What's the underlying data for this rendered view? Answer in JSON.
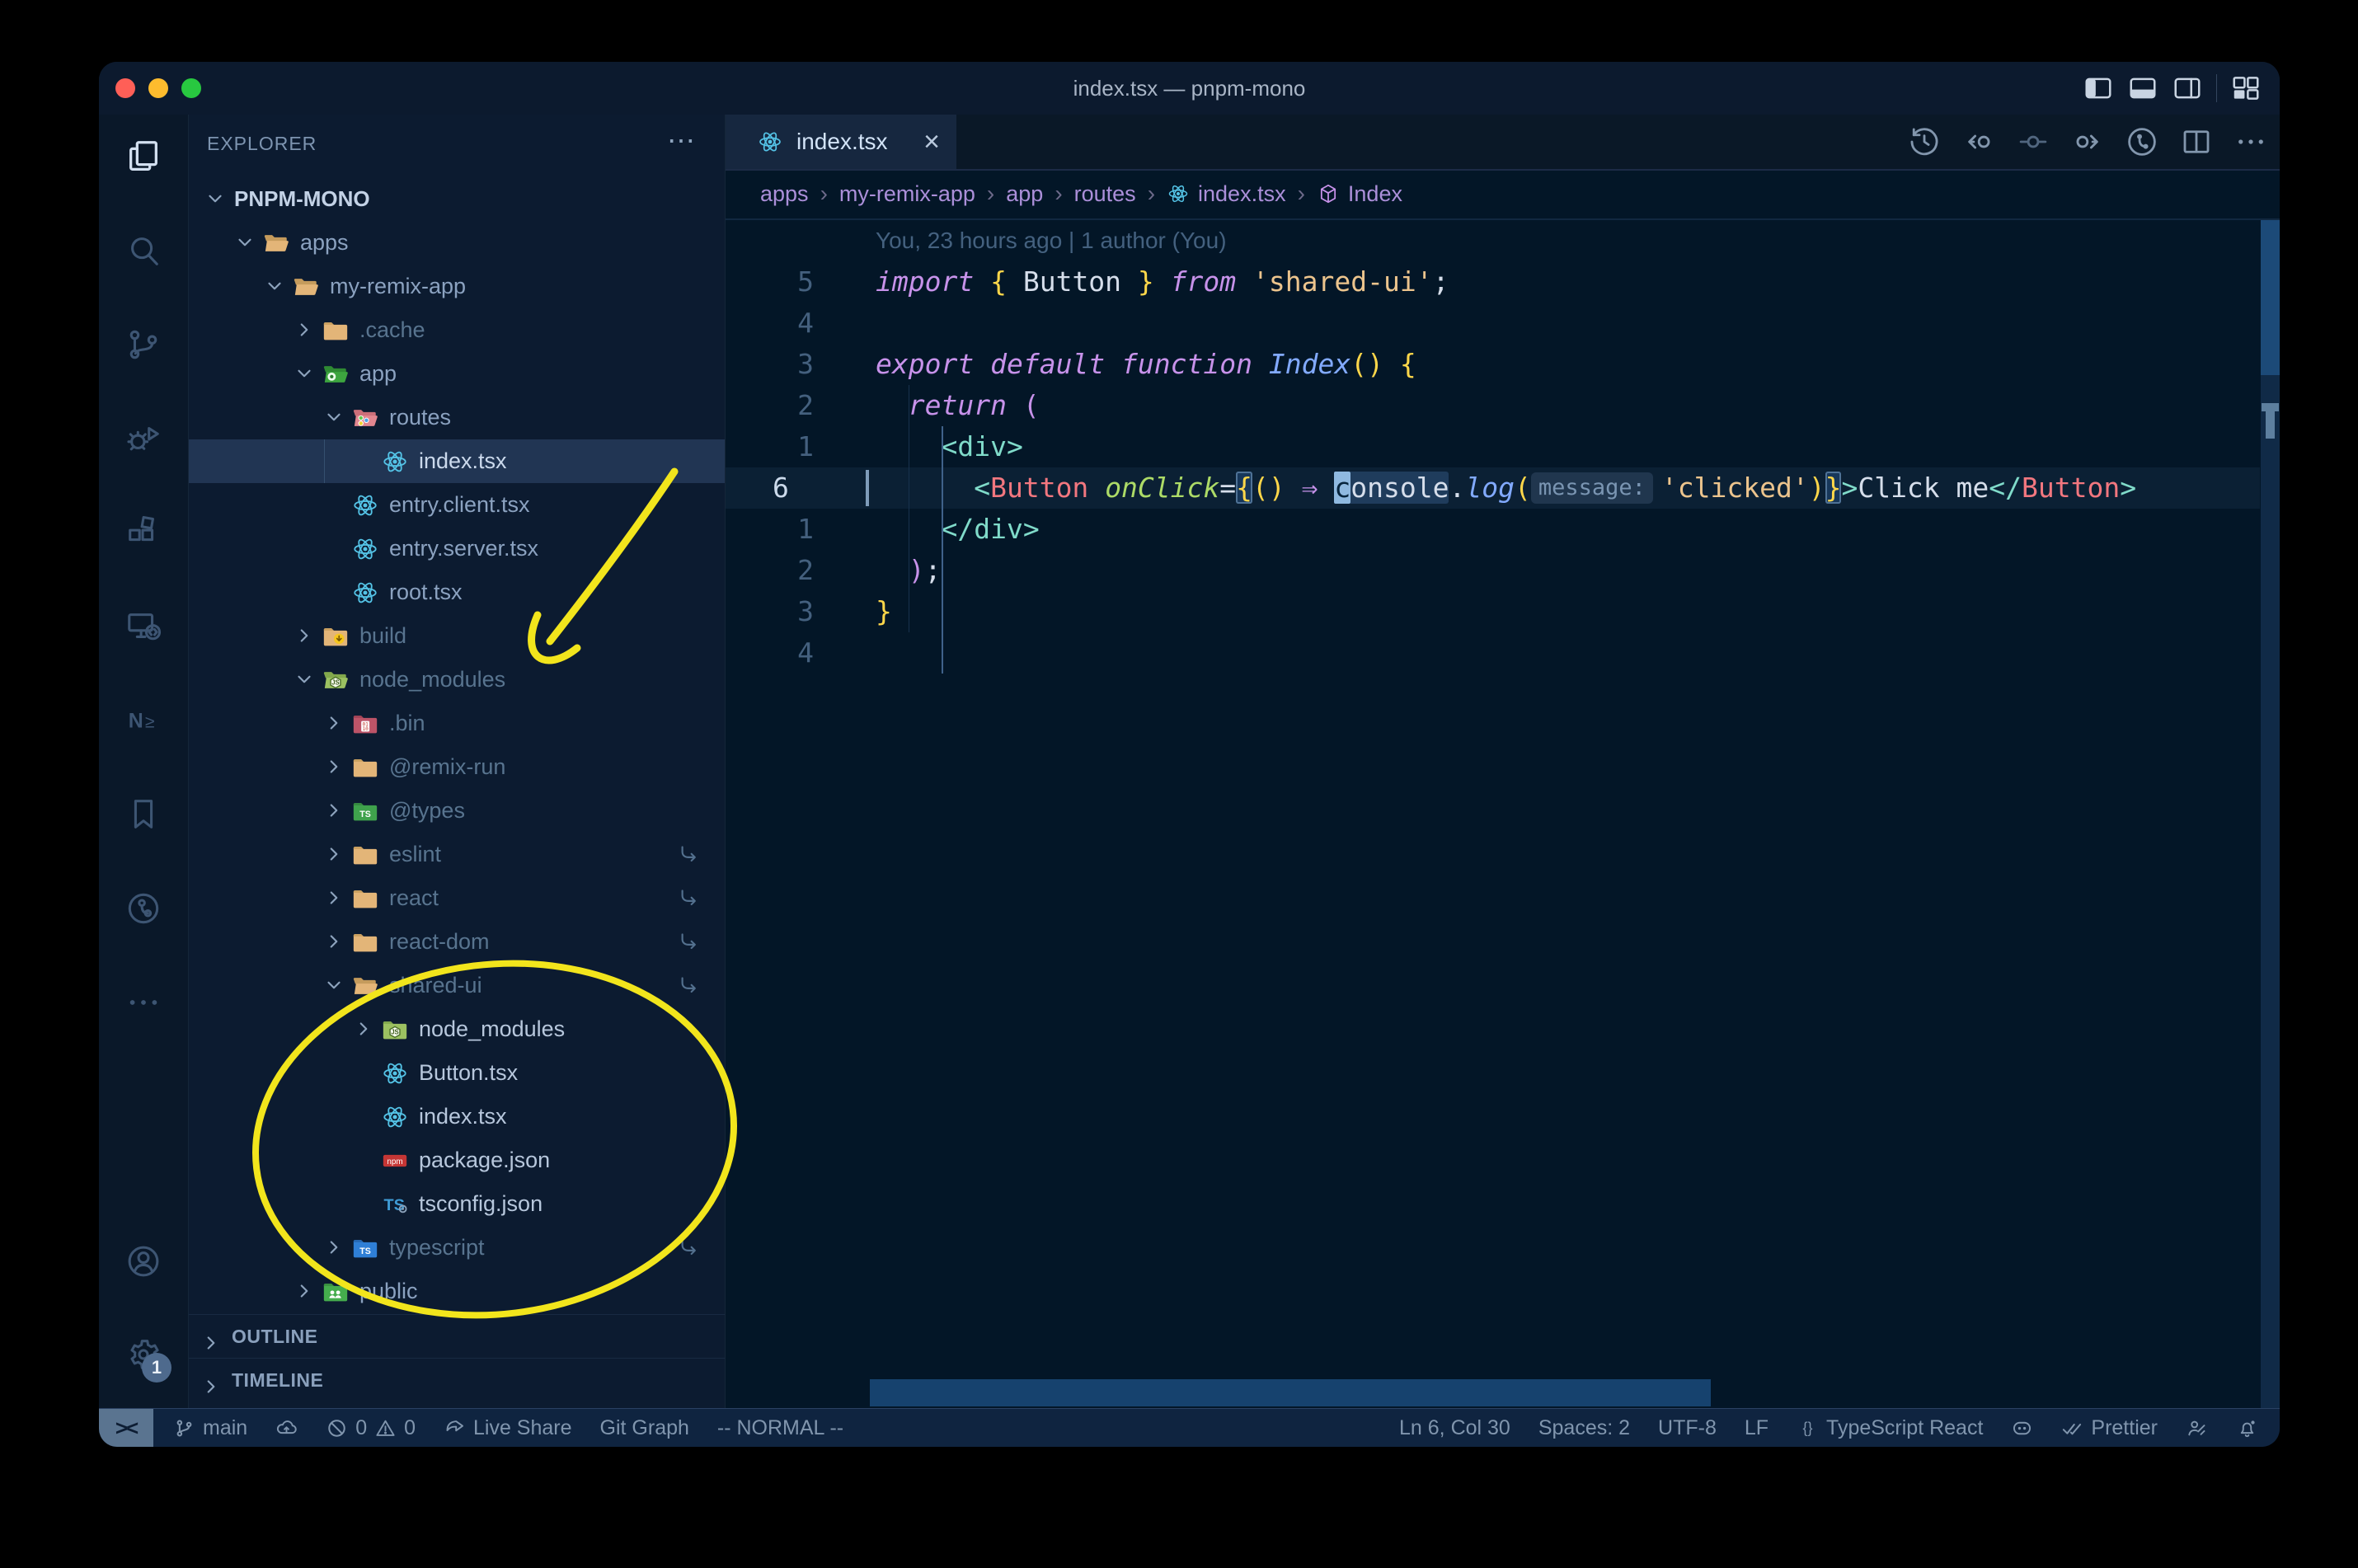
{
  "window": {
    "title": "index.tsx — pnpm-mono"
  },
  "activity_bar": {
    "top": [
      {
        "id": "explorer",
        "active": true
      },
      {
        "id": "search"
      },
      {
        "id": "source-control"
      },
      {
        "id": "run-debug"
      },
      {
        "id": "extensions"
      },
      {
        "id": "remote-explorer"
      },
      {
        "id": "nx-console"
      },
      {
        "id": "bookmarks"
      },
      {
        "id": "gitlens"
      },
      {
        "id": "more"
      }
    ],
    "bottom": [
      {
        "id": "accounts"
      },
      {
        "id": "settings",
        "badge": "1"
      }
    ]
  },
  "explorer": {
    "header": "EXPLORER",
    "header_more": "⋯",
    "sections": [
      "OUTLINE",
      "TIMELINE"
    ],
    "tree": [
      {
        "label": "PNPM-MONO",
        "level": 0,
        "chevron": "down",
        "icon": "none",
        "tone": "root"
      },
      {
        "label": "apps",
        "level": 1,
        "chevron": "down",
        "icon": "folder-open",
        "tone": "normal"
      },
      {
        "label": "my-remix-app",
        "level": 2,
        "chevron": "down",
        "icon": "folder-open",
        "tone": "normal"
      },
      {
        "label": ".cache",
        "level": 3,
        "chevron": "right",
        "icon": "folder",
        "tone": "dim"
      },
      {
        "label": "app",
        "level": 3,
        "chevron": "down",
        "icon": "folder-app",
        "tone": "normal"
      },
      {
        "label": "routes",
        "level": 4,
        "chevron": "down",
        "icon": "folder-routes",
        "tone": "normal"
      },
      {
        "label": "index.tsx",
        "level": 5,
        "chevron": "none",
        "icon": "react",
        "tone": "selected",
        "selected": true
      },
      {
        "label": "entry.client.tsx",
        "level": 4,
        "chevron": "none",
        "icon": "react",
        "tone": "normal"
      },
      {
        "label": "entry.server.tsx",
        "level": 4,
        "chevron": "none",
        "icon": "react",
        "tone": "normal"
      },
      {
        "label": "root.tsx",
        "level": 4,
        "chevron": "none",
        "icon": "react",
        "tone": "normal"
      },
      {
        "label": "build",
        "level": 3,
        "chevron": "right",
        "icon": "folder-build",
        "tone": "dim"
      },
      {
        "label": "node_modules",
        "level": 3,
        "chevron": "down",
        "icon": "folder-node-open",
        "tone": "dim"
      },
      {
        "label": ".bin",
        "level": 4,
        "chevron": "right",
        "icon": "folder-bin",
        "tone": "dim"
      },
      {
        "label": "@remix-run",
        "level": 4,
        "chevron": "right",
        "icon": "folder",
        "tone": "dim"
      },
      {
        "label": "@types",
        "level": 4,
        "chevron": "right",
        "icon": "folder-types",
        "tone": "dim"
      },
      {
        "label": "eslint",
        "level": 4,
        "chevron": "right",
        "icon": "folder",
        "tone": "dim",
        "symlink": true
      },
      {
        "label": "react",
        "level": 4,
        "chevron": "right",
        "icon": "folder",
        "tone": "dim",
        "symlink": true
      },
      {
        "label": "react-dom",
        "level": 4,
        "chevron": "right",
        "icon": "folder",
        "tone": "dim",
        "symlink": true
      },
      {
        "label": "shared-ui",
        "level": 4,
        "chevron": "down",
        "icon": "folder-open",
        "tone": "dim",
        "symlink": true
      },
      {
        "label": "node_modules",
        "level": 5,
        "chevron": "right",
        "icon": "folder-node",
        "tone": "bright"
      },
      {
        "label": "Button.tsx",
        "level": 5,
        "chevron": "none",
        "icon": "react",
        "tone": "bright"
      },
      {
        "label": "index.tsx",
        "level": 5,
        "chevron": "none",
        "icon": "react",
        "tone": "bright"
      },
      {
        "label": "package.json",
        "level": 5,
        "chevron": "none",
        "icon": "npm",
        "tone": "bright"
      },
      {
        "label": "tsconfig.json",
        "level": 5,
        "chevron": "none",
        "icon": "tsconfig",
        "tone": "bright"
      },
      {
        "label": "typescript",
        "level": 4,
        "chevron": "right",
        "icon": "folder-ts",
        "tone": "dim",
        "symlink": true
      },
      {
        "label": "public",
        "level": 3,
        "chevron": "right",
        "icon": "folder-public",
        "tone": "normal"
      }
    ]
  },
  "editor": {
    "tab": {
      "label": "index.tsx",
      "close": "×"
    },
    "breadcrumbs": [
      {
        "label": "apps"
      },
      {
        "label": "my-remix-app"
      },
      {
        "label": "app"
      },
      {
        "label": "routes"
      },
      {
        "label": "index.tsx",
        "icon": "react"
      },
      {
        "label": "Index",
        "icon": "symbol"
      }
    ],
    "blame": "You, 23 hours ago | 1 author (You)",
    "lines": [
      {
        "n": "5",
        "tokens": [
          [
            "kw",
            "import"
          ],
          [
            "c0",
            " "
          ],
          [
            "y",
            "{"
          ],
          [
            "c0",
            " Button "
          ],
          [
            "y",
            "}"
          ],
          [
            "c0",
            " "
          ],
          [
            "kw",
            "from"
          ],
          [
            "c0",
            " "
          ],
          [
            "str",
            "'shared-ui'"
          ],
          [
            "c0",
            ";"
          ]
        ]
      },
      {
        "n": "4",
        "tokens": []
      },
      {
        "n": "3",
        "tokens": [
          [
            "kw",
            "export"
          ],
          [
            "c0",
            " "
          ],
          [
            "kw",
            "default"
          ],
          [
            "c0",
            " "
          ],
          [
            "kw",
            "function"
          ],
          [
            "c0",
            " "
          ],
          [
            "fn",
            "Index"
          ],
          [
            "y",
            "()"
          ],
          [
            "c0",
            " "
          ],
          [
            "y",
            "{"
          ]
        ]
      },
      {
        "n": "2",
        "tokens": [
          [
            "c0",
            "  "
          ],
          [
            "kw",
            "return"
          ],
          [
            "c0",
            " "
          ],
          [
            "pk",
            "("
          ]
        ]
      },
      {
        "n": "1",
        "tokens": [
          [
            "c0",
            "    "
          ],
          [
            "tag",
            "<div>"
          ]
        ]
      },
      {
        "n": "6",
        "cur": true,
        "tokens": [
          [
            "c0",
            "      "
          ],
          [
            "tag",
            "<"
          ],
          [
            "cmp",
            "Button"
          ],
          [
            "c0",
            " "
          ],
          [
            "attr",
            "onClick"
          ],
          [
            "c0",
            "="
          ],
          [
            "ybox",
            "{"
          ],
          [
            "y",
            "()"
          ],
          [
            "c0",
            " "
          ],
          [
            "pk",
            "⇒"
          ],
          [
            "c0",
            " "
          ],
          [
            "cursor",
            "c"
          ],
          [
            "word",
            "onsole"
          ],
          [
            "c0",
            "."
          ],
          [
            "fn",
            "log"
          ],
          [
            "y",
            "("
          ],
          [
            "inlay",
            "message:"
          ],
          [
            "str",
            "'clicked'"
          ],
          [
            "y",
            ")"
          ],
          [
            "ybox",
            "}"
          ],
          [
            "tag",
            ">"
          ],
          [
            "c0",
            "Click me"
          ],
          [
            "tag",
            "</"
          ],
          [
            "cmp",
            "Button"
          ],
          [
            "tag",
            ">"
          ]
        ]
      },
      {
        "n": "1",
        "tokens": [
          [
            "c0",
            "    "
          ],
          [
            "tag",
            "</div>"
          ]
        ]
      },
      {
        "n": "2",
        "tokens": [
          [
            "c0",
            "  "
          ],
          [
            "pk",
            ")"
          ],
          [
            "c0",
            ";"
          ]
        ]
      },
      {
        "n": "3",
        "tokens": [
          [
            "y",
            "}"
          ]
        ]
      },
      {
        "n": "4",
        "tokens": []
      }
    ]
  },
  "status_bar": {
    "remote": "><",
    "left": [
      {
        "icon": "branch",
        "text": "main"
      },
      {
        "icon": "cloud-upload",
        "text": ""
      },
      {
        "icon": "error",
        "text": "0",
        "icon2": "warning",
        "text2": "0"
      },
      {
        "icon": "live-share",
        "text": "Live Share"
      },
      {
        "text": "Git Graph"
      },
      {
        "text": "-- NORMAL --"
      }
    ],
    "right": [
      {
        "text": "Ln 6, Col 30"
      },
      {
        "text": "Spaces: 2"
      },
      {
        "text": "UTF-8"
      },
      {
        "text": "LF"
      },
      {
        "icon": "braces",
        "text": "TypeScript React"
      },
      {
        "icon": "copilot",
        "text": ""
      },
      {
        "icon": "double-check",
        "text": "Prettier"
      },
      {
        "icon": "feedback",
        "text": ""
      },
      {
        "icon": "bell",
        "text": ""
      }
    ]
  },
  "colors": {
    "annotation_yellow": "#f2e51c",
    "react_blue": "#54c3e6",
    "selection_bg": "#213553"
  }
}
